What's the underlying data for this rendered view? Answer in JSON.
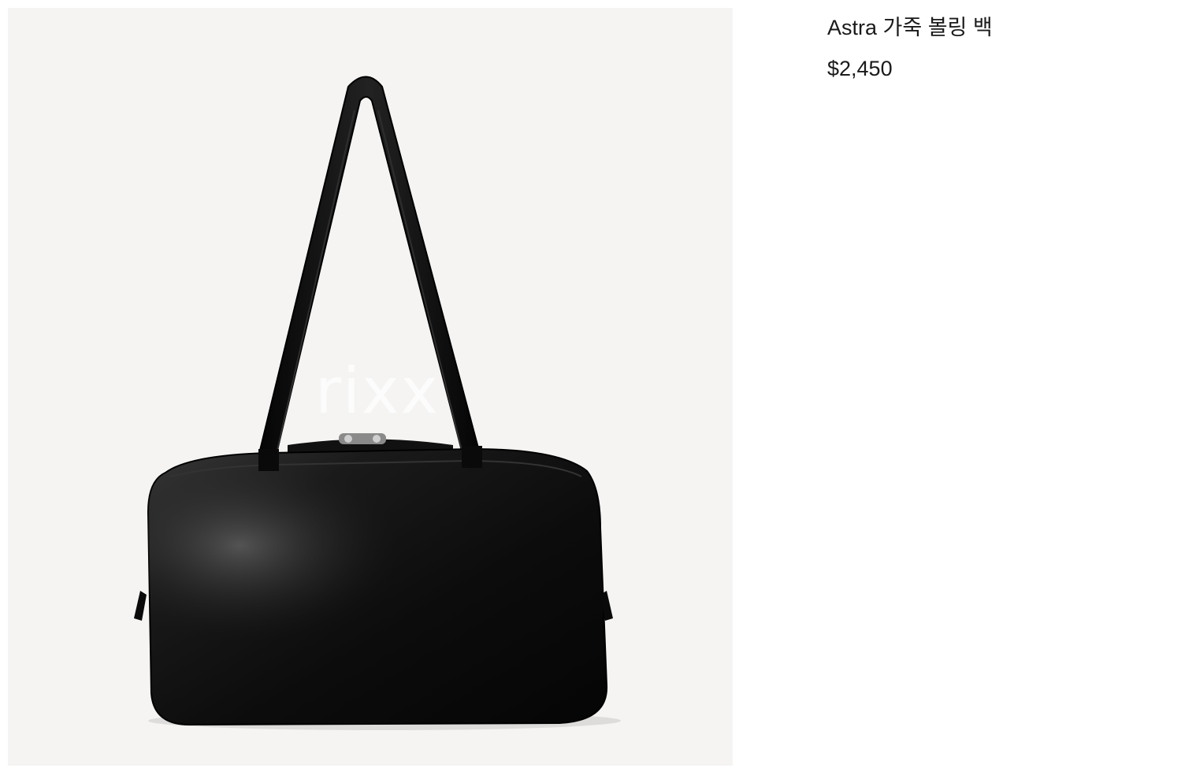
{
  "product": {
    "title": "Astra 가죽 볼링 백",
    "price": "$2,450",
    "image_watermark": "rixx",
    "image_subject": "black-leather-bowling-bag"
  },
  "colors": {
    "image_background": "#f5f4f2",
    "bag": "#0d0d0d",
    "text": "#1a1a1a"
  }
}
